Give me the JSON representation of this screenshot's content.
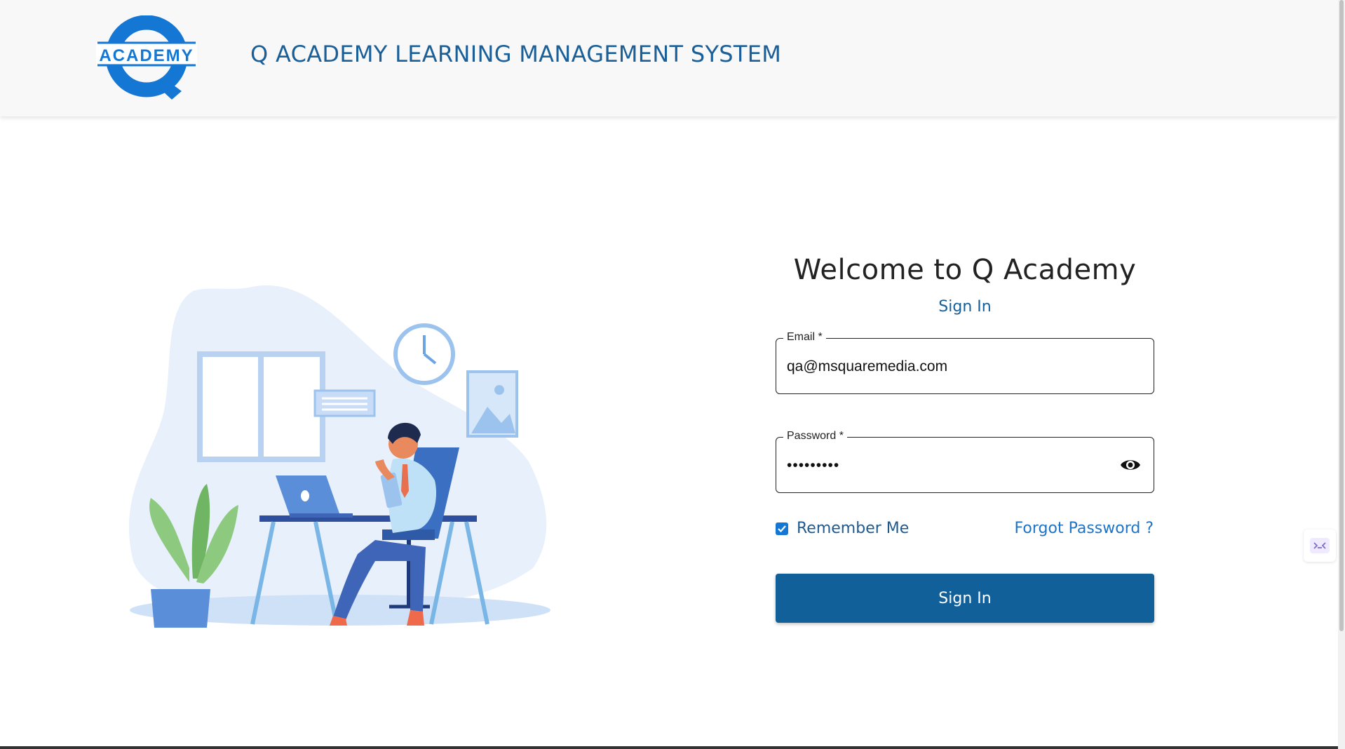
{
  "header": {
    "logo_text": "ACADEMY",
    "title": "Q ACADEMY LEARNING MANAGEMENT SYSTEM"
  },
  "login": {
    "welcome": "Welcome to Q Academy",
    "subtitle": "Sign In",
    "email": {
      "label": "Email *",
      "value": "qa@msquaremedia.com"
    },
    "password": {
      "label": "Password *",
      "value": "•••••••••"
    },
    "remember_me": {
      "label": "Remember Me",
      "checked": true
    },
    "forgot_password": "Forgot Password ?",
    "submit": "Sign In"
  },
  "colors": {
    "brand_blue": "#12609a",
    "logo_blue": "#1577d4",
    "link_blue": "#1d74c6"
  },
  "icons": {
    "password_toggle": "eye-icon",
    "checkbox": "checkmark-icon",
    "side_widget": "code-icon"
  }
}
